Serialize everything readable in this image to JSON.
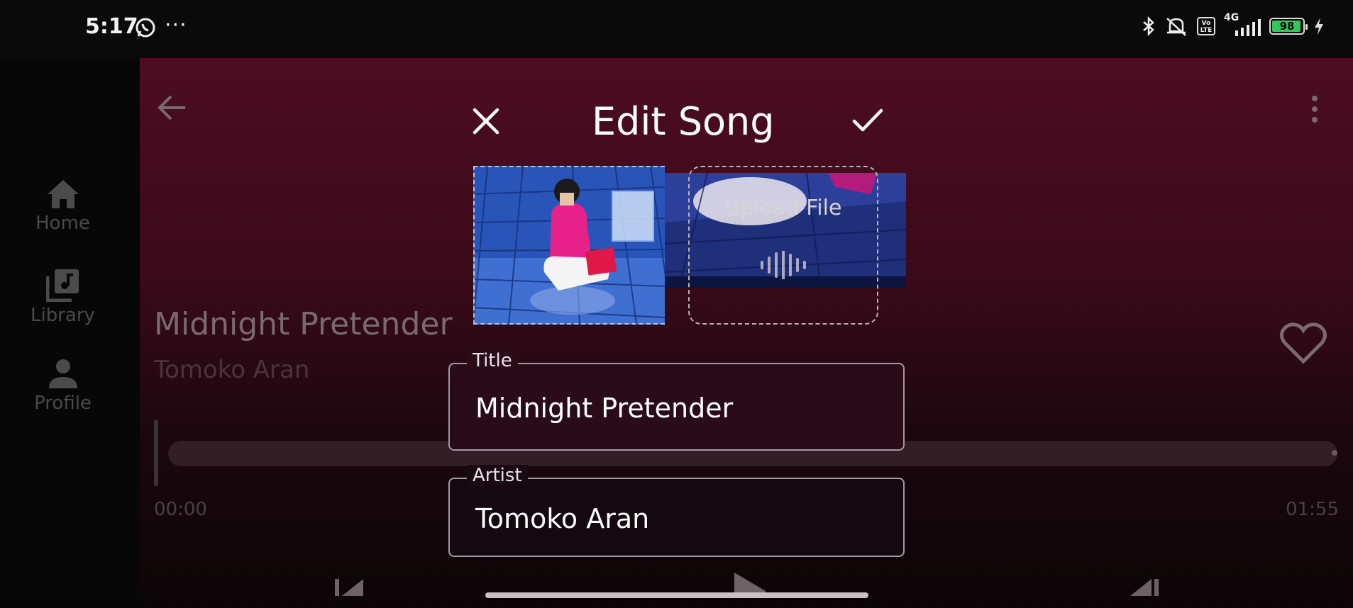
{
  "status_bar": {
    "time": "5:17",
    "more": "···",
    "network": "4G",
    "volte": "Vo LTE",
    "battery": "98"
  },
  "sidebar": {
    "items": [
      {
        "label": "Home",
        "icon": "home-icon"
      },
      {
        "label": "Library",
        "icon": "library-music-icon"
      },
      {
        "label": "Profile",
        "icon": "person-icon"
      }
    ]
  },
  "player": {
    "song_title": "Midnight Pretender",
    "artist": "Tomoko Aran",
    "time_elapsed": "00:00",
    "time_total": "01:55"
  },
  "dialog": {
    "title": "Edit Song",
    "upload_label": "Upload File",
    "fields": {
      "title": {
        "label": "Title",
        "value": "Midnight Pretender"
      },
      "artist": {
        "label": "Artist",
        "value": "Tomoko Aran"
      }
    }
  },
  "colors": {
    "accent_bg": "#4d0c22",
    "text_primary": "#ffffff",
    "battery_green": "#34c759"
  }
}
